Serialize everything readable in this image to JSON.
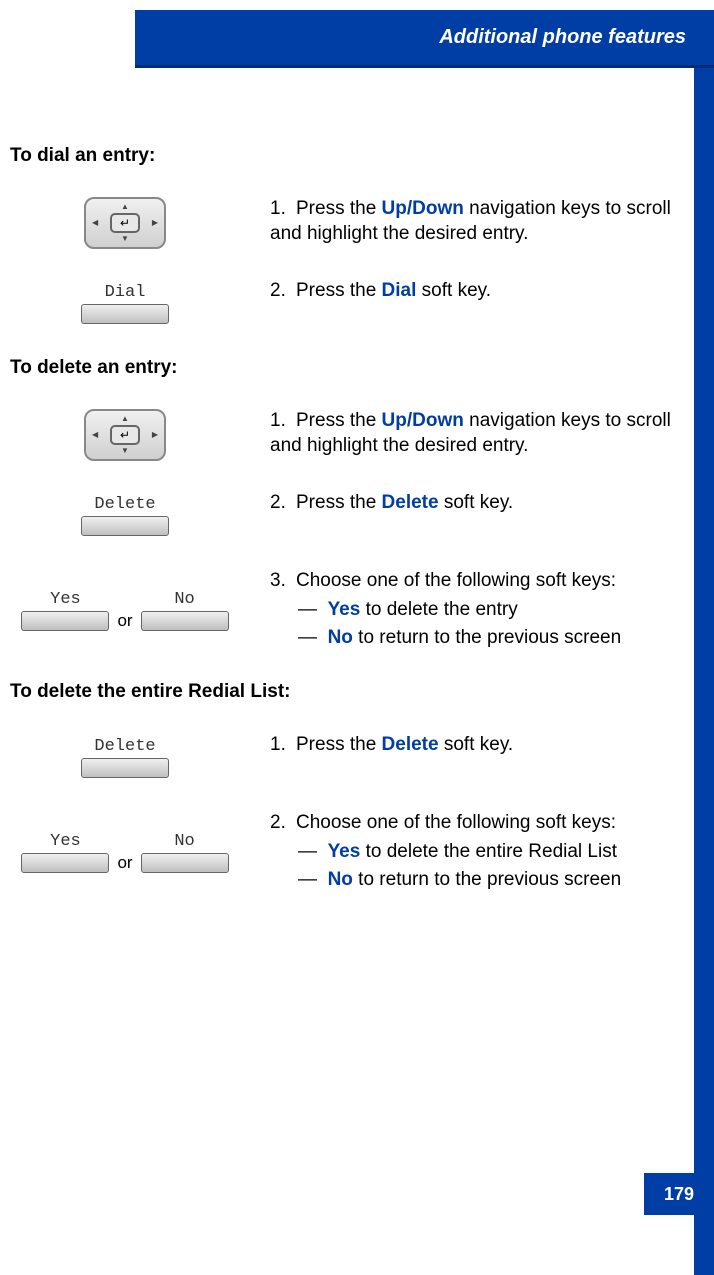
{
  "header": {
    "title": "Additional phone features"
  },
  "page_number": "179",
  "sections": {
    "dial": {
      "heading": "To dial an entry:",
      "step1": {
        "num": "1.",
        "pre": "Press the ",
        "key": "Up/Down",
        "post": " navigation keys to scroll and highlight the desired entry."
      },
      "step2": {
        "num": "2.",
        "pre": "Press the ",
        "key": "Dial",
        "post": " soft key.",
        "softkey_label": "Dial"
      }
    },
    "delete_entry": {
      "heading": "To delete an entry:",
      "step1": {
        "num": "1.",
        "pre": "Press the ",
        "key": "Up/Down",
        "post": " navigation keys to scroll and highlight the desired entry."
      },
      "step2": {
        "num": "2.",
        "pre": "Press the ",
        "key": "Delete",
        "post": " soft key.",
        "softkey_label": "Delete"
      },
      "step3": {
        "num": "3.",
        "intro": "Choose one of the following soft keys:",
        "yes_label": "Yes",
        "yes_text": " to delete the entry",
        "no_label": "No",
        "no_text": " to return to the previous screen",
        "softkey_yes": "Yes",
        "softkey_no": "No",
        "or": "or"
      }
    },
    "delete_list": {
      "heading": "To delete the entire Redial List:",
      "step1": {
        "num": "1.",
        "pre": "Press the ",
        "key": "Delete",
        "post": " soft key.",
        "softkey_label": "Delete"
      },
      "step2": {
        "num": "2.",
        "intro": "Choose one of the following soft keys:",
        "yes_label": "Yes",
        "yes_text": " to delete the entire Redial List",
        "no_label": "No",
        "no_text": " to return to the previous screen",
        "softkey_yes": "Yes",
        "softkey_no": "No",
        "or": "or"
      }
    }
  }
}
